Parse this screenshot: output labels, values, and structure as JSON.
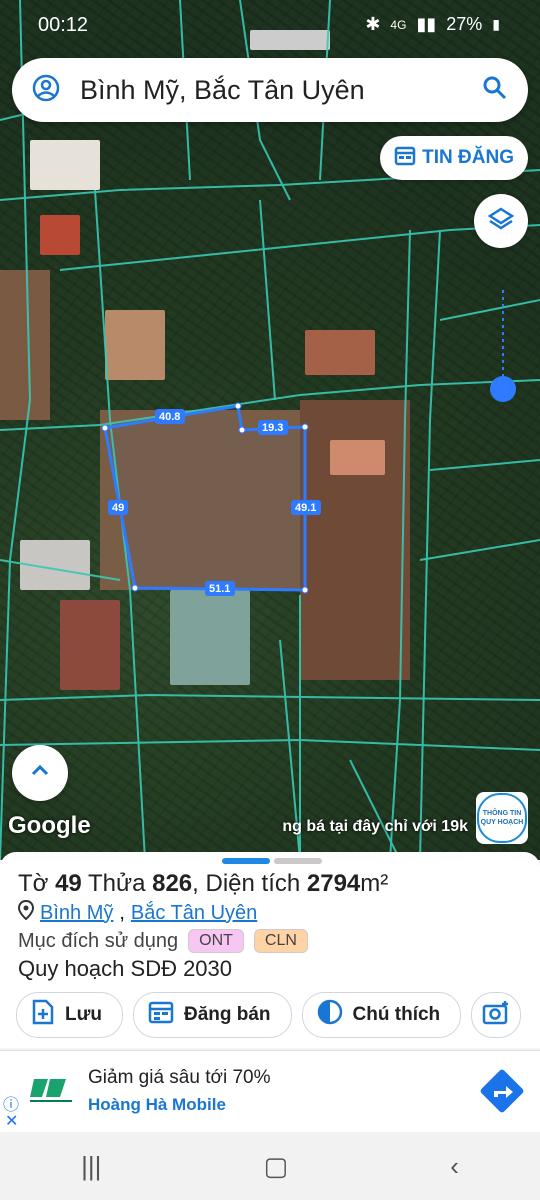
{
  "status": {
    "time": "00:12",
    "network": "4G",
    "battery": "27%"
  },
  "search": {
    "location": "Bình Mỹ, Bắc Tân Uyên"
  },
  "map": {
    "post_button": "TIN ĐĂNG",
    "google_label": "Google",
    "ad_banner": "ng bá tại đây chỉ với 19k",
    "qh_logo": "THÔNG TIN QUY HOẠCH",
    "edges": [
      "40.8",
      "19.3",
      "49",
      "49.1",
      "51.1"
    ]
  },
  "parcel": {
    "to_label": "Tờ",
    "to_num": "49",
    "thua_label": "Thửa",
    "thua_num": "826",
    "area_label": "Diện tích",
    "area_val": "2794",
    "area_unit": "m²",
    "addr1": "Bình Mỹ",
    "addr2": "Bắc Tân Uyên",
    "purpose_label": "Mục đích sử dụng",
    "tags": [
      "ONT",
      "CLN"
    ],
    "plan": "Quy hoạch SDĐ 2030"
  },
  "actions": {
    "save": "Lưu",
    "sell": "Đăng bán",
    "legend": "Chú thích"
  },
  "ad": {
    "title": "Giảm giá sâu tới 70%",
    "sponsor": "Hoàng Hà Mobile"
  },
  "colors": {
    "accent": "#1976d2",
    "parcel": "#2f7bff",
    "tag_ont": "#f7c6f2",
    "tag_cln": "#ffd3a6"
  }
}
